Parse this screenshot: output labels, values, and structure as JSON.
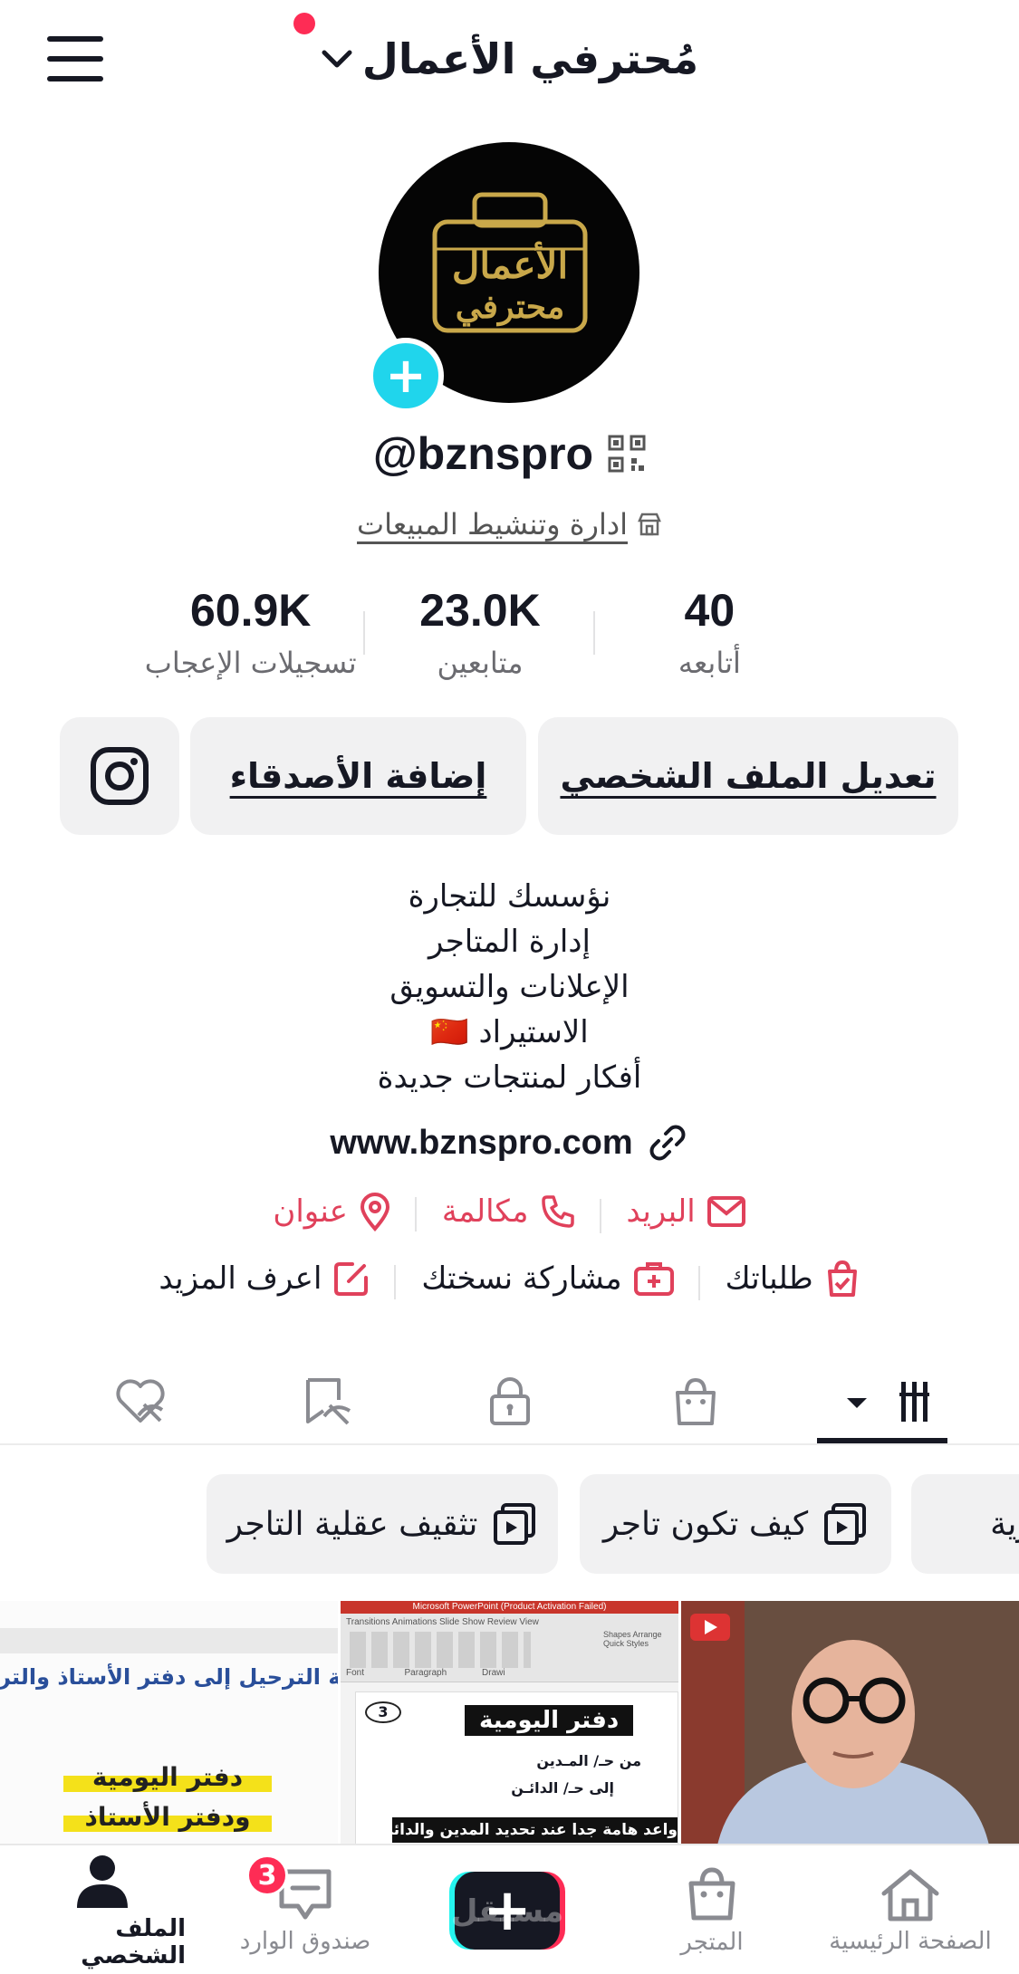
{
  "header": {
    "title": "مُحترفي الأعمال"
  },
  "profile": {
    "avatar_text_top": "الأعمال",
    "avatar_text_bottom": "محترفي",
    "handle": "@bznspro",
    "category": "ادارة وتنشيط المبيعات"
  },
  "stats": [
    {
      "value": "40",
      "label": "أتابعه"
    },
    {
      "value": "23.0K",
      "label": "متابعين"
    },
    {
      "value": "60.9K",
      "label": "تسجيلات الإعجاب"
    }
  ],
  "actions": {
    "edit_profile": "تعديل الملف الشخصي",
    "add_friends": "إضافة الأصدقاء"
  },
  "bio": {
    "line1": "نؤسسك للتجارة",
    "line2": "إدارة المتاجر",
    "line3": "الإعلانات والتسويق",
    "line4": "الاستيراد 🇨🇳",
    "line5": "أفكار لمنتجات جديدة"
  },
  "link": "www.bznspro.com",
  "contacts": {
    "email": "البريد",
    "call": "مكالمة",
    "address": "عنوان"
  },
  "extras": {
    "orders": "طلباتك",
    "share": "مشاركة نسختك",
    "learn_more": "اعرف المزيد"
  },
  "playlists": [
    {
      "label": "تجارية"
    },
    {
      "label": "كيف تكون تاجر"
    },
    {
      "label": "تثقيف عقلية التاجر"
    }
  ],
  "thumbs": {
    "left_heading": "يفية الترحيل إلى دفتر الأستاذ والترصيد:",
    "left_line1": "دفتر اليومية",
    "left_line2": "ودفتر الأستاذ",
    "mid_title": "دفتر اليومية",
    "mid_num": "3",
    "mid_line1": "من حـ/   المـدين",
    "mid_line2": "إلى حـ/   الدائـن",
    "mid_footer": "واعد هامة جدا عند تحديد المدين والدائن",
    "mid_window_title": "Microsoft PowerPoint (Product Activation Failed)",
    "mid_ribbon_tabs": "Transitions   Animations   Slide Show   Review   View",
    "mid_ribbon_groups": "Font                Paragraph              Drawi",
    "mid_ribbon_tools": "Shapes Arrange Quick Styles"
  },
  "bottom_nav": {
    "home": "الصفحة الرئيسية",
    "shop": "المتجر",
    "inbox": "صندوق الوارد",
    "inbox_badge": "3",
    "profile": "الملف الشخصي",
    "watermark": "مستقل"
  },
  "colors": {
    "accent_red": "#fe2c55",
    "contact_red": "#e0415b",
    "plus_cyan": "#20d5ec",
    "gold": "#c9a84a"
  }
}
